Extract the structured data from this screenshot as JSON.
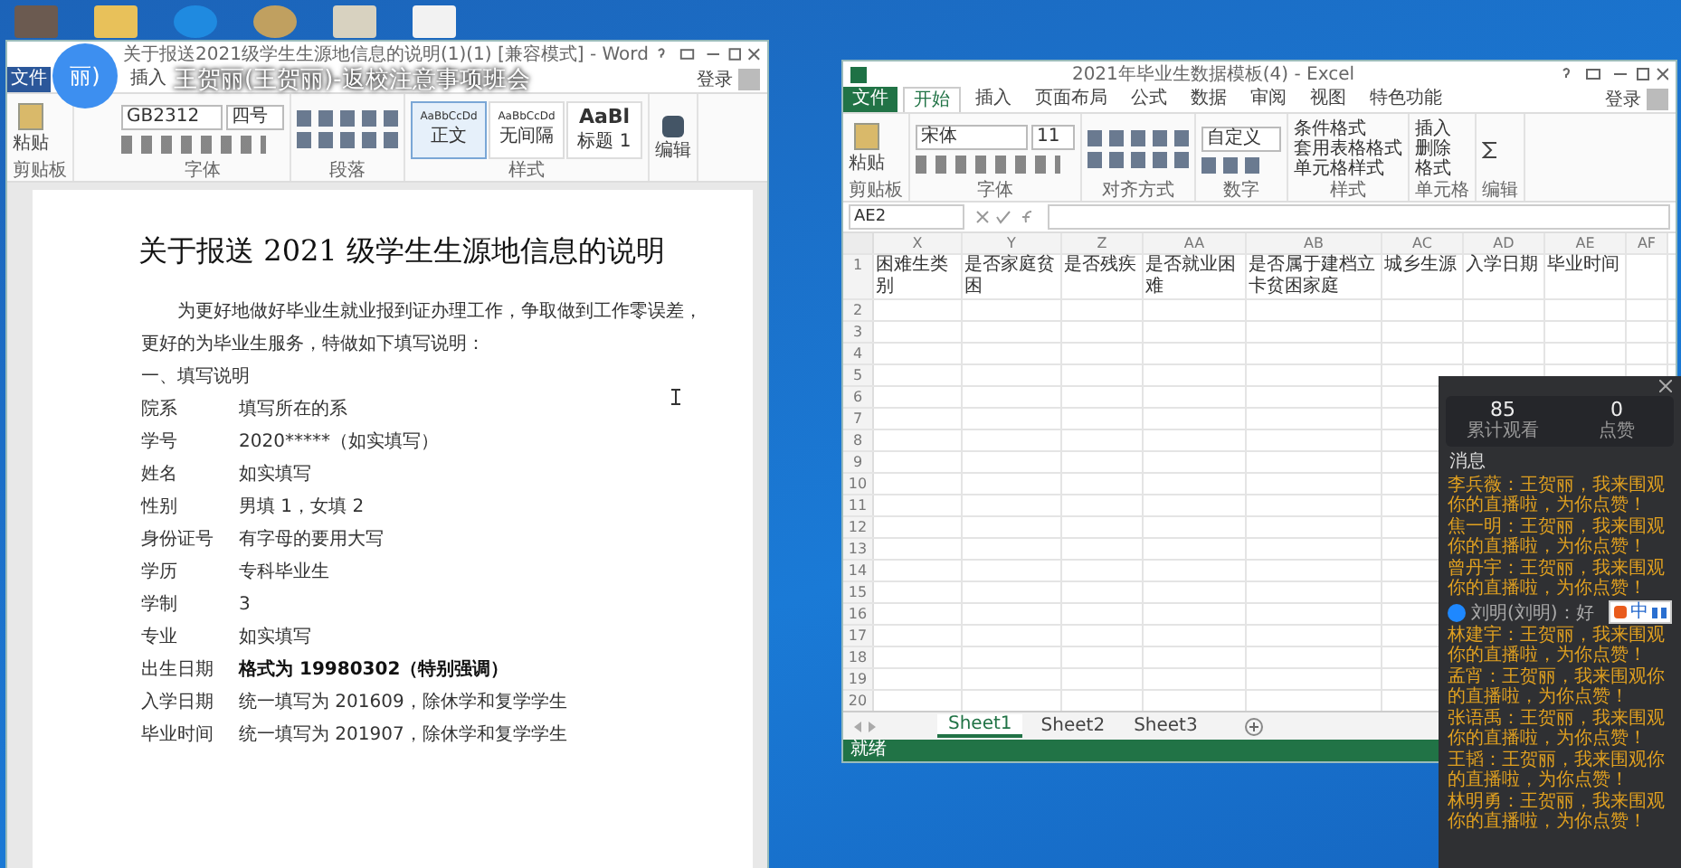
{
  "desktop_icons": [
    {
      "kind": "photo"
    },
    {
      "kind": "folder"
    },
    {
      "kind": "k"
    },
    {
      "kind": "disc"
    },
    {
      "kind": "doc"
    },
    {
      "kind": "word"
    }
  ],
  "stream": {
    "avatar": "丽)",
    "title": "王贺丽(王贺丽)-返校注意事项班会"
  },
  "word": {
    "title": "关于报送2021级学生生源地信息的说明(1)(1) [兼容模式] - Word",
    "tabs": [
      {
        "label": "文件",
        "selected": true
      },
      {
        "label": "插入",
        "selected": false
      }
    ],
    "login": "登录",
    "ribbon": {
      "paste": "粘贴",
      "font": "GB2312",
      "size": "四号",
      "styles": [
        {
          "sample": "AaBbCcDd",
          "name": "正文",
          "selected": true
        },
        {
          "sample": "AaBbCcDd",
          "name": "无间隔",
          "selected": false
        },
        {
          "sample": "AaBl",
          "name": "标题 1",
          "selected": false
        }
      ],
      "edit": "编辑",
      "groups": [
        "剪贴板",
        "字体",
        "段落",
        "样式"
      ]
    },
    "doc": {
      "title": "关于报送 2021 级学生生源地信息的说明",
      "intro": "为更好地做好毕业生就业报到证办理工作，争取做到工作零误差，更好的为毕业生服务，特做如下填写说明：",
      "heading": "一、填写说明",
      "fields": [
        {
          "label": "院系",
          "value": "填写所在的系",
          "bold": false
        },
        {
          "label": "学号",
          "value": "2020*****（如实填写）",
          "bold": false
        },
        {
          "label": "姓名",
          "value": "如实填写",
          "bold": false
        },
        {
          "label": "性别",
          "value": "男填 1，女填 2",
          "bold": false
        },
        {
          "label": "身份证号",
          "value": "有字母的要用大写",
          "bold": false
        },
        {
          "label": "学历",
          "value": "专科毕业生",
          "bold": false
        },
        {
          "label": "学制",
          "value": "3",
          "bold": false
        },
        {
          "label": "专业",
          "value": "如实填写",
          "bold": false
        },
        {
          "label": "出生日期",
          "value": "格式为 19980302（特别强调）",
          "bold": true
        },
        {
          "label": "入学日期",
          "value": "统一填写为 201609，除休学和复学学生",
          "bold": false
        },
        {
          "label": "毕业时间",
          "value": "统一填写为 201907，除休学和复学学生",
          "bold": false
        }
      ]
    }
  },
  "excel": {
    "title": "2021年毕业生数据模板(4) - Excel",
    "tabs": [
      {
        "label": "文件",
        "selected": false
      },
      {
        "label": "开始",
        "selected": true
      },
      {
        "label": "插入",
        "selected": false
      },
      {
        "label": "页面布局",
        "selected": false
      },
      {
        "label": "公式",
        "selected": false
      },
      {
        "label": "数据",
        "selected": false
      },
      {
        "label": "审阅",
        "selected": false
      },
      {
        "label": "视图",
        "selected": false
      },
      {
        "label": "特色功能",
        "selected": false
      }
    ],
    "login": "登录",
    "ribbon": {
      "paste": "粘贴",
      "font": "宋体",
      "size": "11",
      "number_format": "自定义",
      "style_items": [
        "条件格式",
        "套用表格格式",
        "单元格样式"
      ],
      "cell_items": [
        "插入",
        "删除",
        "格式"
      ],
      "groups": [
        "剪贴板",
        "字体",
        "对齐方式",
        "数字",
        "样式",
        "单元格",
        "编辑"
      ]
    },
    "name_box": "AE2",
    "columns": [
      {
        "letter": "X",
        "header": "困难生类别"
      },
      {
        "letter": "Y",
        "header": "是否家庭贫困"
      },
      {
        "letter": "Z",
        "header": "是否残疾"
      },
      {
        "letter": "AA",
        "header": "是否就业困难"
      },
      {
        "letter": "AB",
        "header": "是否属于建档立卡贫困家庭"
      },
      {
        "letter": "AC",
        "header": "城乡生源"
      },
      {
        "letter": "AD",
        "header": "入学日期"
      },
      {
        "letter": "AE",
        "header": "毕业时间"
      },
      {
        "letter": "AF"
      }
    ],
    "row_numbers": [
      "1",
      "2",
      "3",
      "4",
      "5",
      "6",
      "7",
      "8",
      "9",
      "10",
      "11",
      "12",
      "13",
      "14",
      "15",
      "16",
      "17",
      "18",
      "19",
      "20"
    ],
    "sheets": [
      {
        "label": "Sheet1",
        "selected": true
      },
      {
        "label": "Sheet2",
        "selected": false
      },
      {
        "label": "Sheet3",
        "selected": false
      }
    ],
    "status": "就绪"
  },
  "live_panel": {
    "stats": [
      {
        "value": "85",
        "label": "累计观看"
      },
      {
        "value": "0",
        "label": "点赞"
      }
    ],
    "messages_label": "消息",
    "messages": [
      {
        "kind": "gift",
        "text": "李兵薇：王贺丽，我来围观你的直播啦，为你点赞！"
      },
      {
        "kind": "gift",
        "text": "焦一明：王贺丽，我来围观你的直播啦，为你点赞！"
      },
      {
        "kind": "gift",
        "text": "曾丹宇：王贺丽，我来围观你的直播啦，为你点赞！"
      },
      {
        "kind": "chat",
        "text": "刘明(刘明)：好"
      },
      {
        "kind": "gift",
        "text": "林建宇：王贺丽，我来围观你的直播啦，为你点赞！"
      },
      {
        "kind": "gift",
        "text": "孟宵：王贺丽，我来围观你的直播啦，为你点赞！"
      },
      {
        "kind": "gift",
        "text": "张语禹：王贺丽，我来围观你的直播啦，为你点赞！"
      },
      {
        "kind": "gift",
        "text": "王韬：王贺丽，我来围观你的直播啦，为你点赞！"
      },
      {
        "kind": "gift",
        "text": "林明勇：王贺丽，我来围观你的直播啦，为你点赞！"
      }
    ]
  },
  "ime_bar": {
    "mode": "中"
  }
}
